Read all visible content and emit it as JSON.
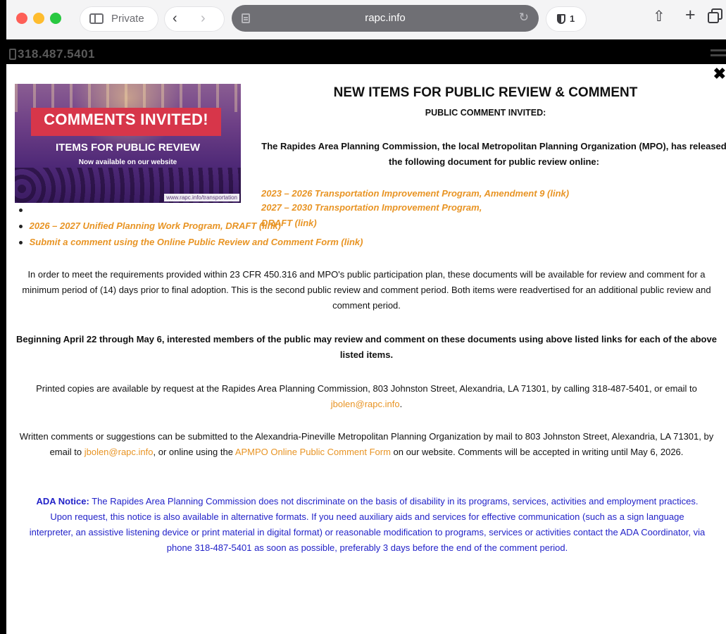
{
  "browser": {
    "private_label": "Private",
    "address": "rapc.info",
    "tracker_count": "1",
    "back_glyph": "‹",
    "forward_glyph": "›",
    "reload_glyph": "↻",
    "share_glyph": "⇧",
    "new_tab_glyph": "+",
    "icons": [
      "sidebar-icon",
      "back-icon",
      "forward-icon",
      "site-settings-icon",
      "reload-icon",
      "shield-icon",
      "share-icon",
      "new-tab-icon",
      "tab-overview-icon"
    ]
  },
  "site_header": {
    "phone": "318.487.5401"
  },
  "modal": {
    "close_glyph": "✖",
    "banner": {
      "title": "COMMENTS INVITED!",
      "subtitle": "ITEMS FOR PUBLIC REVIEW",
      "tagline": "Now available on our website",
      "url": "www.rapc.info/transportation"
    },
    "heading": "NEW ITEMS FOR PUBLIC REVIEW & COMMENT",
    "subheading": "PUBLIC COMMENT INVITED:",
    "intro": "The Rapides Area Planning Commission, the local Metropolitan Planning Organization (MPO), has released the following document for public review online:",
    "items": [
      "2023 – 2026 Transportation Improvement Program, Amendment 9 (link)",
      "2027 – 2030 Transportation Improvement Program, DRAFT (link)",
      "2026 – 2027 Unified Planning Work Program, DRAFT (link)",
      "Submit a comment using the Online Public Review and Comment Form (link)"
    ],
    "requirements": "In order to meet the requirements provided within 23 CFR 450.316 and MPO's public participation plan, these documents will be available for review and comment for a minimum period of (14) days prior to final adoption. This is the second public review and comment period. Both items were readvertised for an additional public review and comment period.",
    "dates": "Beginning April 22 through May 6, interested members of the public may review and comment on these documents using above listed links for each of the above listed items.",
    "printed": {
      "before": "Printed copies are available by request at the Rapides Area Planning Commission, 803 Johnston Street, Alexandria, LA 71301, by calling 318-487-5401, or email to ",
      "email": "jbolen@rapc.info",
      "after": "."
    },
    "written": {
      "part1": "Written comments or suggestions can be submitted to the Alexandria-Pineville Metropolitan Planning Organization by mail to 803 Johnston Street, Alexandria, LA 71301, by email to ",
      "email": "jbolen@rapc.info",
      "part2": ", or online using the ",
      "form_link": "APMPO Online Public Comment Form",
      "part3": " on our website. Comments will be accepted in writing until May 6, 2026."
    },
    "ada": {
      "label": "ADA Notice:",
      "text": " The Rapides Area Planning Commission does not discriminate on the basis of disability in its programs, services, activities and employment practices. Upon request, this notice is also available in alternative formats. If you need auxiliary aids and services for effective communication (such as a sign language interpreter, an assistive listening device or print material in digital format) or reasonable modification to programs, services or activities contact the ADA Coordinator, via phone 318-487-5401 as soon as possible, preferably 3 days before the end of the comment period."
    }
  },
  "colors": {
    "link": "#e89424",
    "ada": "#2222c8",
    "banner_red": "#d7364a",
    "banner_purple": "#6d3f86"
  }
}
